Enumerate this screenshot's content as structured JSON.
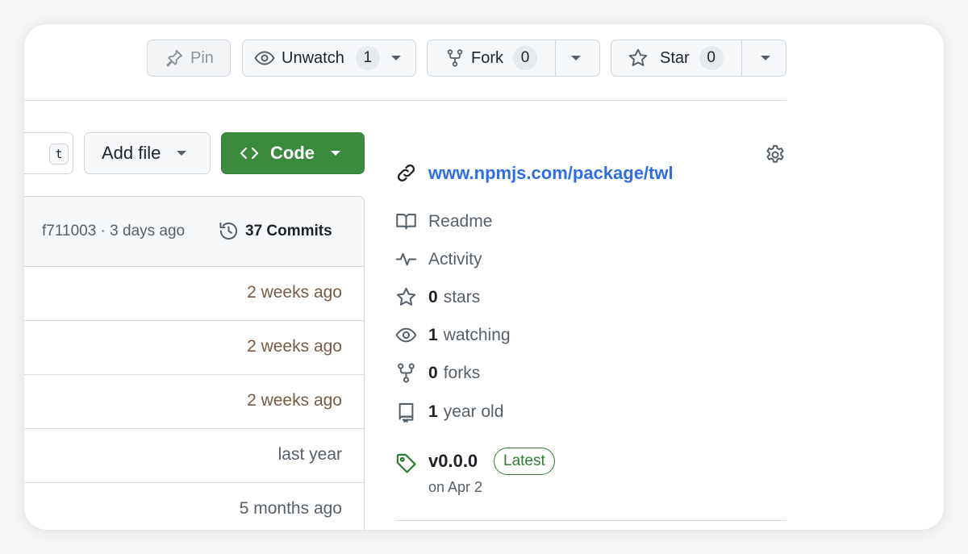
{
  "header": {
    "pin_label": "Pin",
    "unwatch_label": "Unwatch",
    "watch_count": "1",
    "fork_label": "Fork",
    "fork_count": "0",
    "star_label": "Star",
    "star_count": "0"
  },
  "toolbar": {
    "shortcut_key": "t",
    "add_file_label": "Add file",
    "code_label": "Code"
  },
  "commit_bar": {
    "hash_time": "f711003 · 3 days ago",
    "commits_label": "37 Commits"
  },
  "file_rows": [
    {
      "time": "2 weeks ago"
    },
    {
      "time": "2 weeks ago"
    },
    {
      "time": "2 weeks ago"
    },
    {
      "time": "last year"
    },
    {
      "time": "5 months ago"
    }
  ],
  "sidebar": {
    "link": "www.npmjs.com/package/twl",
    "readme": "Readme",
    "activity": "Activity",
    "stars_count": "0",
    "stars_label": "stars",
    "watching_count": "1",
    "watching_label": "watching",
    "forks_count": "0",
    "forks_label": "forks",
    "age_count": "1",
    "age_label": "year old",
    "release_version": "v0.0.0",
    "release_badge": "Latest",
    "release_date": "on Apr 2"
  },
  "colors": {
    "code_button": "#3b8b3f",
    "link": "#2f6ee0",
    "recent_time": "#7a5a45",
    "muted": "#57606a",
    "latest_badge": "#2f7d32"
  }
}
